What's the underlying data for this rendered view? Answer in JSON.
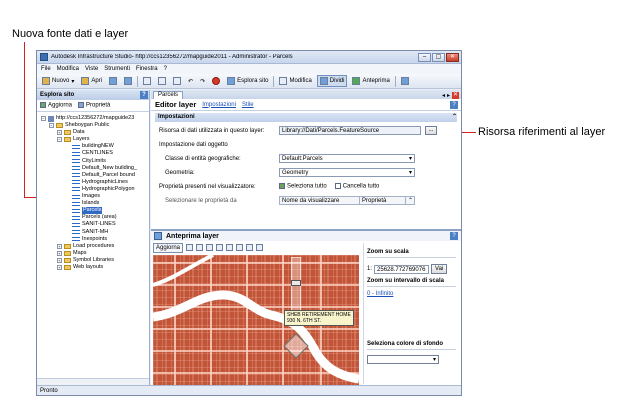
{
  "callouts": {
    "new_source": "Nuova fonte dati e layer",
    "resource_ref": "Risorsa riferimenti al layer"
  },
  "window": {
    "title": "Autodesk Infrastructure Studio- http://ccs12356272/mapguide2011 - Administrator - Parcels",
    "controls": [
      "–",
      "▢",
      "✕"
    ]
  },
  "menu": [
    "File",
    "Modifica",
    "Viste",
    "Strumenti",
    "Finestra",
    "?"
  ],
  "toolbar": {
    "new": "Nuovo",
    "open": "Apri",
    "site_explorer": "Esplora sito",
    "edit": "Modifica",
    "split": "Dividi",
    "preview": "Anteprima"
  },
  "explorer": {
    "title": "Esplora sito",
    "refresh": "Aggiorna",
    "properties": "Proprietà",
    "tree": [
      {
        "label": "http://ccs12356272/mapguide23",
        "indent": 0,
        "kind": "db",
        "exp": "−"
      },
      {
        "label": "Sheboygan Public",
        "indent": 1,
        "kind": "folder",
        "exp": "−"
      },
      {
        "label": "Data",
        "indent": 2,
        "kind": "folder",
        "exp": "+"
      },
      {
        "label": "Layers",
        "indent": 2,
        "kind": "folder",
        "exp": "−"
      },
      {
        "label": "buildingNEW",
        "indent": 3,
        "kind": "layer"
      },
      {
        "label": "CENTLINES",
        "indent": 3,
        "kind": "layer"
      },
      {
        "label": "CityLimits",
        "indent": 3,
        "kind": "layer"
      },
      {
        "label": "Default_New building_",
        "indent": 3,
        "kind": "layer"
      },
      {
        "label": "Default_Parcel bound",
        "indent": 3,
        "kind": "layer"
      },
      {
        "label": "HydrographicLines",
        "indent": 3,
        "kind": "layer"
      },
      {
        "label": "HydrographicPolygon",
        "indent": 3,
        "kind": "layer"
      },
      {
        "label": "Images",
        "indent": 3,
        "kind": "layer"
      },
      {
        "label": "Islands",
        "indent": 3,
        "kind": "layer"
      },
      {
        "label": "Parcels",
        "indent": 3,
        "kind": "layer",
        "selected": true
      },
      {
        "label": "Parcels (area)",
        "indent": 3,
        "kind": "layer"
      },
      {
        "label": "SANIT-LINES",
        "indent": 3,
        "kind": "layer"
      },
      {
        "label": "SANIT-MH",
        "indent": 3,
        "kind": "layer"
      },
      {
        "label": "Inexpoints",
        "indent": 3,
        "kind": "layer"
      },
      {
        "label": "Load procedures",
        "indent": 2,
        "kind": "folder",
        "exp": "+"
      },
      {
        "label": "Maps",
        "indent": 2,
        "kind": "folder",
        "exp": "+"
      },
      {
        "label": "Symbol Libraries",
        "indent": 2,
        "kind": "folder",
        "exp": "+"
      },
      {
        "label": "Web layouts",
        "indent": 2,
        "kind": "folder",
        "exp": "+"
      }
    ]
  },
  "tab": {
    "label": "Parcels"
  },
  "editor": {
    "title": "Editor layer",
    "link_settings": "Impostazioni",
    "link_style": "Stile",
    "section": "Impostazioni",
    "resource_label": "Risorsa di dati utilizzata in questo layer:",
    "resource_value": "Library://Dati/Parcels.FeatureSource",
    "browse": "...",
    "data_settings": "Impostazione dati oggetto",
    "class_label": "Classe di entità geografiche:",
    "class_value": "Default:Parcels",
    "geom_label": "Geometria:",
    "geom_value": "Geometry",
    "props_label": "Proprietà presenti nel visualizzatore:",
    "select_all": "Seleziona tutto",
    "clear_all": "Cancella tutto",
    "select_props": "Selezionare le proprietà da",
    "col_display_name": "Nome da visualizzare",
    "col_property": "Proprietà"
  },
  "preview": {
    "title": "Anteprima layer",
    "refresh": "Aggiorna",
    "zoom_scale_title": "Zoom su scala",
    "scale_prefix": "1:",
    "scale_value": "25628.772769076",
    "go": "Vai",
    "zoom_interval_title": "Zoom su intervallo di scala",
    "interval_link": "0 - Infinito",
    "bg_color_title": "Seleziona colore di sfondo",
    "tooltip_line1": "SHEB RETIREMENT HOME",
    "tooltip_line2": "930 N. 6TH ST."
  },
  "status": "Pronto",
  "colors": {
    "parcel_fill": "#c25537",
    "parcel_line": "#f4b8a8",
    "river": "#ffffff",
    "selection": "#316ac5",
    "leader": "#d42020"
  }
}
